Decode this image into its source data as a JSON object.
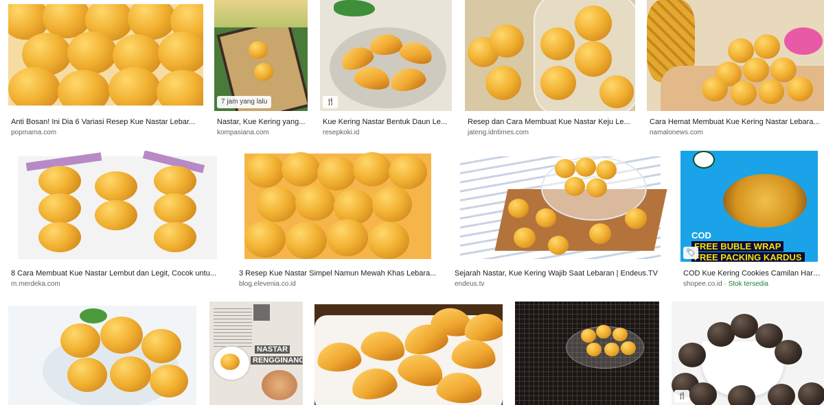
{
  "results": [
    {
      "title": "Anti Bosan! Ini Dia 6 Variasi Resep Kue Nastar Lebar...",
      "source": "popmama.com"
    },
    {
      "title": "Nastar, Kue Kering yang...",
      "source": "kompasiana.com",
      "badge": "7 jam yang lalu"
    },
    {
      "title": "Kue Kering Nastar Bentuk Daun Le...",
      "source": "resepkoki.id",
      "icon": "fork-knife-icon"
    },
    {
      "title": "Resep dan Cara Membuat Kue Nastar Keju Le...",
      "source": "jateng.idntimes.com"
    },
    {
      "title": "Cara Hemat Membuat Kue Kering Nastar Lebara...",
      "source": "namalonews.com"
    },
    {
      "title": "8 Cara Membuat Kue Nastar Lembut dan Legit, Cocok untu...",
      "source": "m.merdeka.com"
    },
    {
      "title": "3 Resep Kue Nastar Simpel Namun Mewah Khas Lebara...",
      "source": "blog.elevenia.co.id"
    },
    {
      "title": "Sejarah Nastar, Kue Kering Wajib Saat Lebaran | Endeus.TV",
      "source": "endeus.tv"
    },
    {
      "title": "COD Kue Kering Cookies Camilan Hari...",
      "source": "shopee.co.id",
      "stock": "Stok tersedia",
      "icon": "tag-icon"
    }
  ],
  "row3": {
    "icon": "fork-knife-icon"
  },
  "overlays": {
    "shopee_cod": "COD",
    "shopee_bubble": "FREE BUBLE WRAP",
    "shopee_packing": "FREE PACKING KARDUS",
    "rengginang_line1": "NASTAR",
    "rengginang_line2": "RENGGINANG"
  },
  "colors": {
    "caption": "#202124",
    "source": "#5f6368",
    "stock": "#188038",
    "shopee_banner": "#1aa3e8",
    "shopee_text": "#f5e400"
  }
}
